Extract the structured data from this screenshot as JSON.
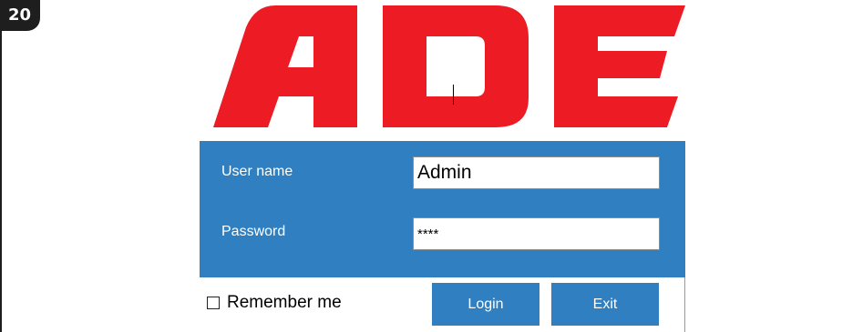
{
  "page": {
    "number": "20"
  },
  "logo": {
    "text": "ADE",
    "color": "#ed1c24"
  },
  "login": {
    "panel_color": "#2f7fc1",
    "username_label": "User name",
    "username_value": "Admin",
    "password_label": "Password",
    "password_value": "****",
    "remember_label": "Remember me",
    "remember_checked": false,
    "login_label": "Login",
    "exit_label": "Exit"
  }
}
